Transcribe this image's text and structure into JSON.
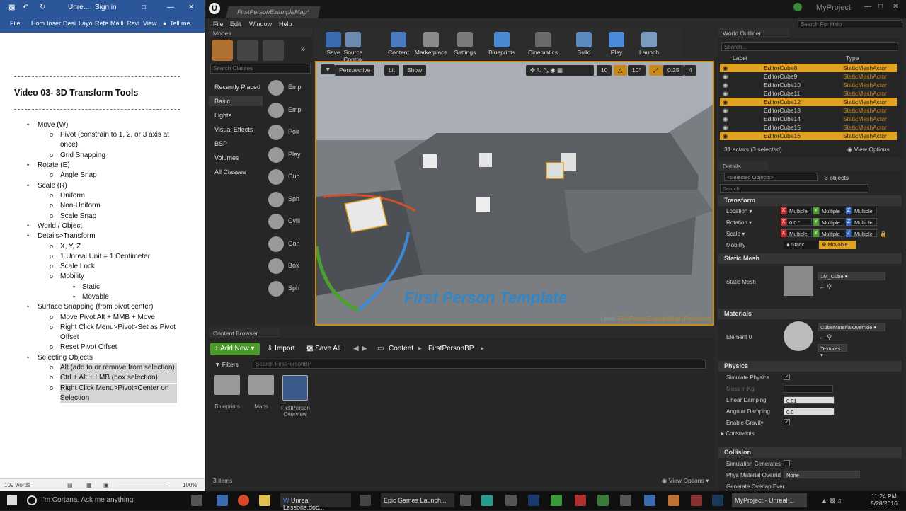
{
  "word": {
    "title_items": [
      "Unre...",
      "Sign in"
    ],
    "ribbon_tabs": [
      "File",
      "Hom",
      "Inser",
      "Desi",
      "Layo",
      "Refe",
      "Maili",
      "Revi",
      "View",
      "Tell me"
    ],
    "doc_title": "Video 03- 3D Transform Tools",
    "outline": [
      {
        "lvl": 1,
        "text": "Move (W)"
      },
      {
        "lvl": 2,
        "text": "Pivot (constrain to 1, 2, or 3 axis at once)"
      },
      {
        "lvl": 2,
        "text": "Grid Snapping"
      },
      {
        "lvl": 1,
        "text": "Rotate (E)"
      },
      {
        "lvl": 2,
        "text": "Angle Snap"
      },
      {
        "lvl": 1,
        "text": "Scale (R)"
      },
      {
        "lvl": 2,
        "text": "Uniform"
      },
      {
        "lvl": 2,
        "text": "Non-Uniform"
      },
      {
        "lvl": 2,
        "text": "Scale Snap"
      },
      {
        "lvl": 1,
        "text": "World / Object"
      },
      {
        "lvl": 1,
        "text": "Details>Transform"
      },
      {
        "lvl": 2,
        "text": "X, Y, Z"
      },
      {
        "lvl": 2,
        "text": "1 Unreal Unit = 1 Centimeter"
      },
      {
        "lvl": 2,
        "text": "Scale Lock"
      },
      {
        "lvl": 2,
        "text": "Mobility"
      },
      {
        "lvl": 3,
        "text": "Static"
      },
      {
        "lvl": 3,
        "text": "Movable"
      },
      {
        "lvl": 1,
        "text": "Surface Snapping (from pivot center)"
      },
      {
        "lvl": 2,
        "text": "Move Pivot Alt + MMB + Move"
      },
      {
        "lvl": 2,
        "text": "Right Click Menu>Pivot>Set as Pivot Offset"
      },
      {
        "lvl": 2,
        "text": "Reset Pivot Offset"
      },
      {
        "lvl": 1,
        "text": "Selecting Objects"
      },
      {
        "lvl": 2,
        "text": "Alt (add to or remove from selection)"
      },
      {
        "lvl": 2,
        "text": "Ctrl + Alt + LMB (box selection)"
      },
      {
        "lvl": 2,
        "text": "Right Click Menu>Pivot>Center on Selection"
      }
    ],
    "status_words": "109 words",
    "zoom": "100%"
  },
  "ue": {
    "map_tab": "FirstPersonExampleMap*",
    "project": "MyProject",
    "search_help": "Search For Help",
    "menu": [
      "File",
      "Edit",
      "Window",
      "Help"
    ],
    "modes_tab": "Modes",
    "search_classes": "Search Classes",
    "categories": [
      "Recently Placed",
      "Basic",
      "Lights",
      "Visual Effects",
      "BSP",
      "Volumes",
      "All Classes"
    ],
    "mode_items": [
      "Emp",
      "Emp",
      "Poir",
      "Play",
      "Cub",
      "Sph",
      "Cylii",
      "Con",
      "Box",
      "Sph"
    ],
    "toolbar": [
      "Save",
      "Source Control",
      "Content",
      "Marketplace",
      "Settings",
      "Blueprints",
      "Cinematics",
      "Build",
      "Play",
      "Launch"
    ],
    "viewport": {
      "perspective": "Perspective",
      "lit": "Lit",
      "show": "Show",
      "grid": "10",
      "angle": "10°",
      "scale": "0.25",
      "speed": "4",
      "template_text": "First Person Template",
      "level_label": "Level:",
      "level_name": "FirstPersonExampleMap (Persistent)"
    },
    "content_browser": {
      "tab": "Content Browser",
      "add_new": "Add New",
      "import": "Import",
      "save_all": "Save All",
      "path": [
        "Content",
        "FirstPersonBP"
      ],
      "filters": "Filters",
      "search": "Search FirstPersonBP",
      "assets": [
        "Blueprints",
        "Maps",
        "FirstPerson Overview"
      ],
      "count": "3 items",
      "view_options": "View Options"
    },
    "outliner": {
      "tab": "World Outliner",
      "search": "Search...",
      "col_label": "Label",
      "col_type": "Type",
      "rows": [
        {
          "label": "EditorCube8",
          "type": "StaticMeshActor",
          "sel": true
        },
        {
          "label": "EditorCube9",
          "type": "StaticMeshActor",
          "sel": false
        },
        {
          "label": "EditorCube10",
          "type": "StaticMeshActor",
          "sel": false
        },
        {
          "label": "EditorCube11",
          "type": "StaticMeshActor",
          "sel": false
        },
        {
          "label": "EditorCube12",
          "type": "StaticMeshActor",
          "sel": true
        },
        {
          "label": "EditorCube13",
          "type": "StaticMeshActor",
          "sel": false
        },
        {
          "label": "EditorCube14",
          "type": "StaticMeshActor",
          "sel": false
        },
        {
          "label": "EditorCube15",
          "type": "StaticMeshActor",
          "sel": false
        },
        {
          "label": "EditorCube16",
          "type": "StaticMeshActor",
          "sel": true
        }
      ],
      "summary": "31 actors (3 selected)",
      "view_options": "View Options"
    },
    "details": {
      "tab": "Details",
      "selected": "<Selected Objects>",
      "objects": "3 objects",
      "search": "Search",
      "transform": "Transform",
      "location": "Location",
      "rotation": "Rotation",
      "scale": "Scale",
      "multiple": "Multiple",
      "rot_x": "0.0 °",
      "mobility": "Mobility",
      "static": "Static",
      "movable": "Movable",
      "static_mesh_sec": "Static Mesh",
      "static_mesh": "Static Mesh",
      "mesh_value": "1M_Cube",
      "materials": "Materials",
      "element0": "Element 0",
      "material_value": "CubeMaterialOverride",
      "textures": "Textures",
      "physics": "Physics",
      "simulate_physics": "Simulate Physics",
      "mass": "Mass in Kg",
      "linear_damping": "Linear Damping",
      "linear_value": "0.01",
      "angular_damping": "Angular Damping",
      "angular_value": "0.0",
      "enable_gravity": "Enable Gravity",
      "constraints": "Constraints",
      "collision": "Collision",
      "sim_generates": "Simulation Generates",
      "phys_material": "Phys Material Overrid",
      "phys_value": "None",
      "gen_overlap": "Generate Overlap Ever"
    }
  },
  "taskbar": {
    "cortana": "I'm Cortana. Ask me anything.",
    "apps": [
      "Unreal Lessons.doc...",
      "Epic Games Launch...",
      "MyProject - Unreal ..."
    ],
    "time": "11:24 PM",
    "date": "5/28/2016"
  },
  "colors": {
    "accent": "#e0a020",
    "word_blue": "#2b579a",
    "ue_bg": "#262626"
  }
}
